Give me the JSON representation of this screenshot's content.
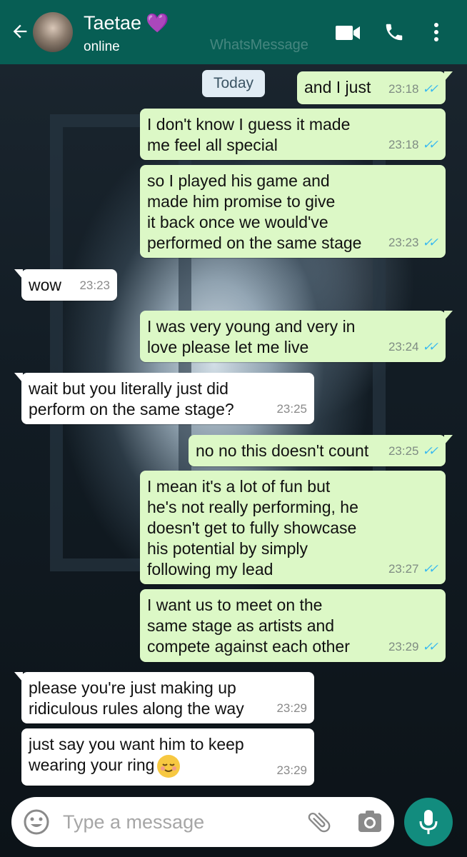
{
  "header": {
    "contact_name": "Taetae",
    "heart": "💜",
    "status": "online",
    "watermark": "WhatsMessage",
    "bg_color": "#075e54"
  },
  "date_chip": "Today",
  "messages": [
    {
      "dir": "out",
      "text": "and I just",
      "time": "23:18"
    },
    {
      "dir": "out",
      "text": "I don't know I guess it made\nme feel all special",
      "time": "23:18"
    },
    {
      "dir": "out",
      "text": "so I played his game and\nmade him promise to give\nit back once we would've\nperformed on the same stage",
      "time": "23:23"
    },
    {
      "dir": "in",
      "text": "wow",
      "time": "23:23"
    },
    {
      "dir": "out",
      "text": "I was very young and very in\nlove please let me live",
      "time": "23:24"
    },
    {
      "dir": "in",
      "text": "wait but you literally just did\nperform on the same stage?",
      "time": "23:25"
    },
    {
      "dir": "out",
      "text": "no no this doesn't count",
      "time": "23:25"
    },
    {
      "dir": "out",
      "text": "I mean it's a lot of fun but\nhe's not really performing, he\ndoesn't get to fully showcase\nhis potential by simply\nfollowing my lead",
      "time": "23:27"
    },
    {
      "dir": "out",
      "text": "I want us to meet on the\nsame stage as artists and\ncompete against each other",
      "time": "23:29"
    },
    {
      "dir": "in",
      "text": "please you're just making up\nridiculous rules along the way",
      "time": "23:29"
    },
    {
      "dir": "in",
      "text": "just say you want him to keep\nwearing your ring",
      "emoji": "relieved-face",
      "time": "23:29"
    }
  ],
  "input": {
    "placeholder": "Type a message"
  },
  "colors": {
    "outgoing_bubble": "#dcf8c6",
    "incoming_bubble": "#ffffff",
    "read_ticks": "#34b7f1",
    "mic_button": "#128c7e"
  }
}
